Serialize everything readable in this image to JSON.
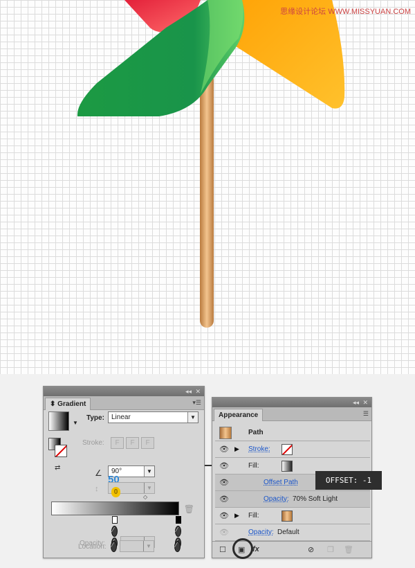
{
  "watermark": "思缘设计论坛 WWW.MISSYUAN.COM",
  "colors": {
    "stick_light": "#f3c48e",
    "stick_dark": "#b97b3f",
    "blade_green": "#1fa24a",
    "blade_orange": "#ffb015",
    "blade_red": "#e8313d"
  },
  "gradient_panel": {
    "tab": "Gradient",
    "type_label": "Type:",
    "type_value": "Linear",
    "stroke_label": "Stroke:",
    "angle_value": "90°",
    "number_50": "50",
    "number_0": "0",
    "opacity_label": "Opacity:",
    "location_label": "Location:"
  },
  "appearance_panel": {
    "tab": "Appearance",
    "header": "Path",
    "rows": [
      {
        "label": "Stroke:"
      },
      {
        "label": "Fill:"
      },
      {
        "label": "Offset Path"
      },
      {
        "label": "Opacity:",
        "value": "70% Soft Light"
      },
      {
        "label": "Fill:"
      },
      {
        "label": "Opacity:",
        "value": "Default"
      }
    ],
    "fx_label": "fx"
  },
  "tooltip": "OFFSET: -1"
}
